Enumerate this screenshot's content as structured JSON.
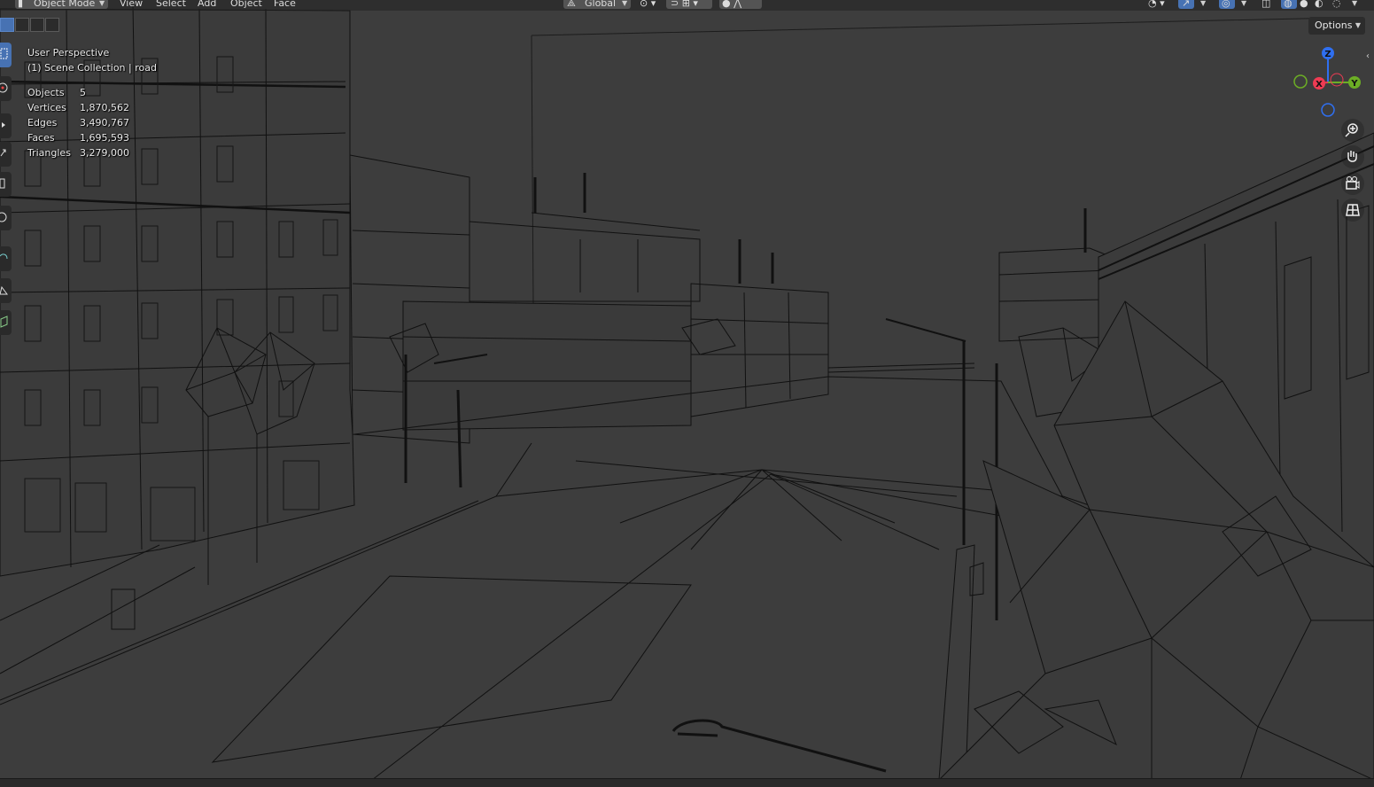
{
  "header": {
    "mode_label": "Object Mode",
    "menus": [
      "View",
      "Select",
      "Add",
      "Object",
      "Face"
    ],
    "orientation_label": "Global"
  },
  "overlay": {
    "view_name": "User Perspective",
    "collection_label": "(1) Scene Collection | road",
    "stats": [
      {
        "label": "Objects",
        "value": "5"
      },
      {
        "label": "Vertices",
        "value": "1,870,562"
      },
      {
        "label": "Edges",
        "value": "3,490,767"
      },
      {
        "label": "Faces",
        "value": "1,695,593"
      },
      {
        "label": "Triangles",
        "value": "3,279,000"
      }
    ]
  },
  "options": {
    "label": "Options"
  },
  "gizmo": {
    "axes": [
      {
        "label": "Z",
        "color": "#2f6ff0"
      },
      {
        "label": "X",
        "color": "#ee3b53"
      },
      {
        "label": "Y",
        "color": "#6cae25"
      }
    ]
  },
  "toolbar": {
    "tools": [
      "select-box",
      "cursor",
      "move",
      "rotate",
      "scale",
      "transform",
      "annotate",
      "measure",
      "add-cube"
    ],
    "active_tool": "select-box"
  },
  "navigation": {
    "buttons": [
      "zoom-icon",
      "hand-pan-icon",
      "camera-icon",
      "perspective-grid-icon"
    ]
  },
  "colors": {
    "viewport_bg": "#3d3d3d",
    "wire": "#0f0f0f",
    "accent": "#4772b3",
    "panel": "#2c2c2c"
  }
}
